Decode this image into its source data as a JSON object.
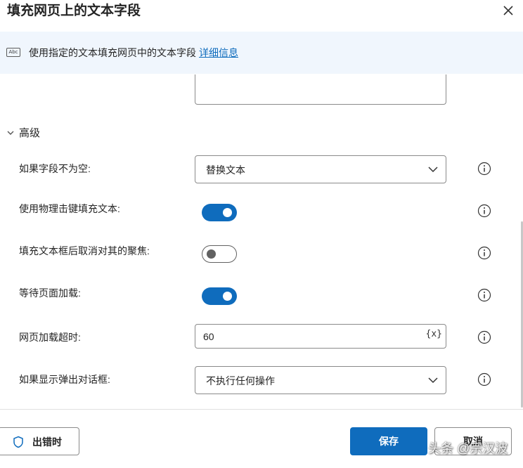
{
  "dialog": {
    "title": "填充网页上的文本字段"
  },
  "banner": {
    "icon": "text-field-abc-icon",
    "icon_text": "Abc",
    "text": "使用指定的文本填充网页中的文本字段",
    "link": "详细信息"
  },
  "advanced": {
    "section_title": "高级",
    "rows": [
      {
        "label": "如果字段不为空:",
        "type": "select",
        "value": "替换文本"
      },
      {
        "label": "使用物理击键填充文本:",
        "type": "toggle",
        "on": true
      },
      {
        "label": "填充文本框后取消对其的聚焦:",
        "type": "toggle",
        "on": false
      },
      {
        "label": "等待页面加载:",
        "type": "toggle",
        "on": true
      },
      {
        "label": "网页加载超时:",
        "type": "input",
        "value": "60",
        "var_button": "{x}"
      },
      {
        "label": "如果显示弹出对话框:",
        "type": "select",
        "value": "不执行任何操作"
      }
    ]
  },
  "footer": {
    "on_error_label": "出错时",
    "save_label": "保存",
    "cancel_label": "取消"
  },
  "watermark": "头条 @宗汉波",
  "colors": {
    "accent": "#0f6cbd",
    "banner_bg": "#f0f6fd",
    "border": "#8a8a8a",
    "text": "#242424"
  }
}
